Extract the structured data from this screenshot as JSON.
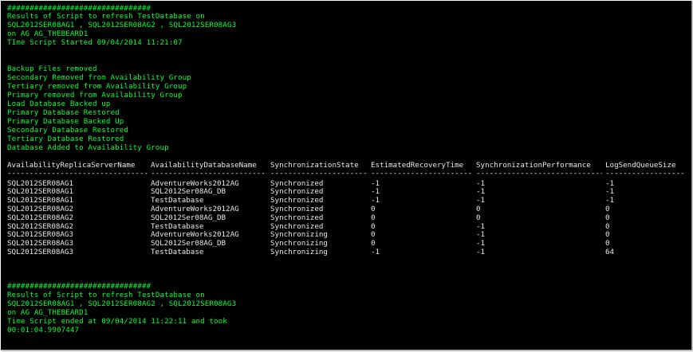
{
  "header_block": {
    "hashes": "################################",
    "line1": "Results of Script to refresh TestDatabase on",
    "line2": "SQL2012SER08AG1 , SQL2012SER08AG2 , SQL2012SER08AG3",
    "line3": "on AG AG_THEBEARD1",
    "line4": "TIme Script Started 09/04/2014 11:21:07"
  },
  "status_lines": [
    "Backup Files removed",
    "Secondary Removed from Availability Group",
    "Tertiary removed from Availability Group",
    "Primary removed from Availability Group",
    "Load Database Backed up",
    "Primary Database Restored",
    "Primary Database Backed Up",
    "Secondary Database Restored",
    "Tertiary Database Restored",
    "Database Added to Availability Group"
  ],
  "table": {
    "columns": [
      "AvailabilityReplicaServerName",
      "AvailabilityDatabaseName",
      "SynchronizationState",
      "EstimatedRecoveryTime",
      "SynchronizationPerformance",
      "LogSendQueueSize"
    ],
    "rows": [
      [
        "SQL2012SER08AG1",
        "AdventureWorks2012AG",
        "Synchronized",
        "-1",
        "-1",
        "-1"
      ],
      [
        "SQL2012SER08AG1",
        "SQL2012Ser08AG_DB",
        "Synchronized",
        "-1",
        "-1",
        "-1"
      ],
      [
        "SQL2012SER08AG1",
        "TestDatabase",
        "Synchronized",
        "-1",
        "-1",
        "-1"
      ],
      [
        "SQL2012SER08AG2",
        "AdventureWorks2012AG",
        "Synchronized",
        "0",
        "0",
        "0"
      ],
      [
        "SQL2012SER08AG2",
        "SQL2012Ser08AG_DB",
        "Synchronized",
        "0",
        "0",
        "0"
      ],
      [
        "SQL2012SER08AG2",
        "TestDatabase",
        "Synchronized",
        "0",
        "-1",
        "0"
      ],
      [
        "SQL2012SER08AG3",
        "AdventureWorks2012AG",
        "Synchronizing",
        "0",
        "-1",
        "0"
      ],
      [
        "SQL2012SER08AG3",
        "SQL2012Ser08AG_DB",
        "Synchronizing",
        "0",
        "-1",
        "0"
      ],
      [
        "SQL2012SER08AG3",
        "TestDatabase",
        "Synchronizing",
        "-1",
        "-1",
        "64"
      ]
    ]
  },
  "footer_block": {
    "hashes": "################################",
    "line1": "Results of Script to refresh TestDatabase on",
    "line2": "SQL2012SER08AG1 , SQL2012SER08AG2 , SQL2012SER08AG3",
    "line3": "on AG AG_THEBEARD1",
    "line4": "Time Script ended at 09/04/2014 11:22:11 and took",
    "line5": "00:01:04.9907447"
  },
  "colors": {
    "background": "#000000",
    "script_output": "#00ff32",
    "table_text": "#eaeaea"
  }
}
